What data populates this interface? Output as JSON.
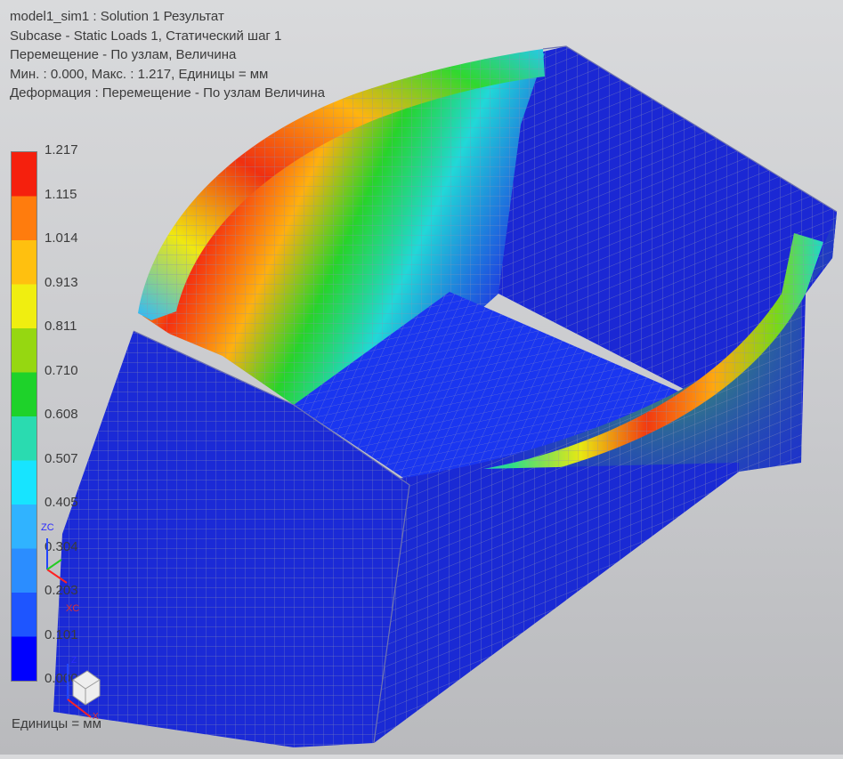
{
  "header": {
    "line1": "model1_sim1 : Solution 1 Результат",
    "line2": "Subcase - Static Loads 1, Статический шаг 1",
    "line3": "Перемещение - По узлам, Величина",
    "line4": "Мин. : 0.000, Макс. : 1.217, Единицы = мм",
    "line5": "Деформация : Перемещение - По узлам Величина"
  },
  "legend": {
    "ticks": [
      "1.217",
      "1.115",
      "1.014",
      "0.913",
      "0.811",
      "0.710",
      "0.608",
      "0.507",
      "0.405",
      "0.304",
      "0.203",
      "0.101",
      "0.000"
    ],
    "units_label": "Единицы = мм",
    "colors": [
      "#0000ff",
      "#1e55ff",
      "#2b8dff",
      "#30b3ff",
      "#17e4ff",
      "#2adbb0",
      "#1ed22a",
      "#96d711",
      "#f0ee10",
      "#ffc00f",
      "#ff7c0d",
      "#f5200d"
    ]
  },
  "triad": {
    "zc_label": "ZC",
    "xc_label": "XC",
    "z_label": "Z",
    "x_label": "X"
  },
  "colors": {
    "background_top": "#d9dadc",
    "background_bottom": "#b9babd",
    "mesh_low": "#1a2bd6",
    "mesh_line": "#8a8fb0",
    "header_text": "#3b3b3b"
  }
}
